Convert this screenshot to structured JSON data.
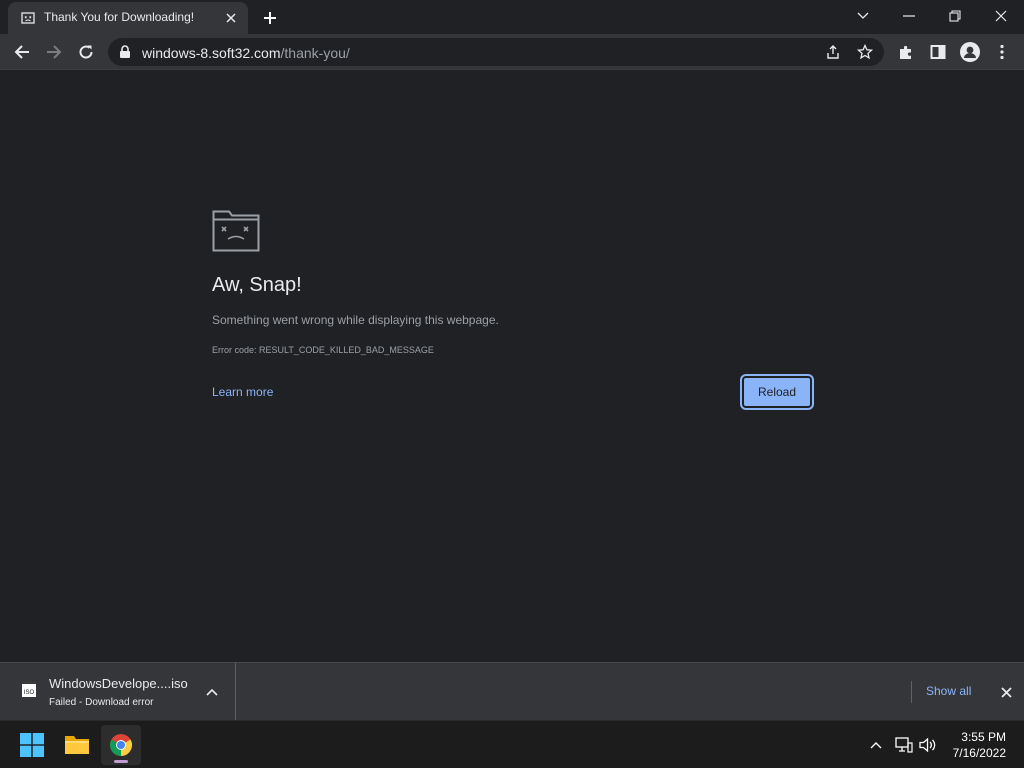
{
  "tab": {
    "title": "Thank You for Downloading!",
    "favicon": "sad-tab-icon"
  },
  "toolbar": {
    "url_host": "windows-8.soft32.com",
    "url_path": "/thank-you/"
  },
  "error": {
    "title": "Aw, Snap!",
    "description": "Something went wrong while displaying this webpage.",
    "code": "Error code: RESULT_CODE_KILLED_BAD_MESSAGE",
    "learn_more": "Learn more",
    "reload": "Reload"
  },
  "download": {
    "filename": "WindowsDevelope....iso",
    "status": "Failed - Download error",
    "file_icon_label": "ISO",
    "show_all": "Show all"
  },
  "taskbar": {
    "time": "3:55 PM",
    "date": "7/16/2022"
  },
  "colors": {
    "page_bg": "#202124",
    "toolbar_bg": "#35363a",
    "accent": "#8ab4f8",
    "text": "#e8eaed",
    "muted_text": "#9aa0a6"
  }
}
